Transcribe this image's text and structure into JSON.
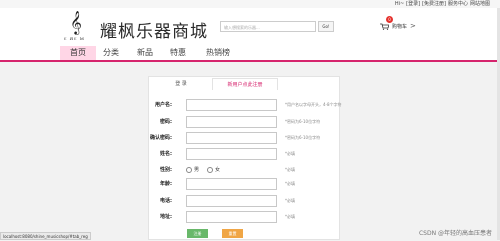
{
  "top_links": [
    "Hi~",
    "[登录]",
    "[免费注册]",
    "服务中心",
    "网站地图"
  ],
  "logo": {
    "sub_text": "Ɛ ЯƐ M"
  },
  "store_name": "耀枫乐器商城",
  "search": {
    "placeholder": "输入想搜索的乐器...",
    "button_label": "Go!"
  },
  "cart": {
    "label": "购物车",
    "count": "0",
    "arrow": ">"
  },
  "nav": {
    "items": [
      {
        "label": "首页",
        "active": true
      },
      {
        "label": "分类",
        "active": false
      },
      {
        "label": "新品",
        "active": false
      },
      {
        "label": "特惠",
        "active": false
      },
      {
        "label": "热销榜",
        "active": false
      }
    ]
  },
  "accent_color": "#d6246d",
  "tabs": {
    "login": "登 录",
    "register": "新用户点此注册"
  },
  "form": {
    "fields": [
      {
        "label": "用户名:",
        "hint": "*用户名以字母开头，4-8个字符"
      },
      {
        "label": "密码:",
        "hint": "*密码为6-10位字符"
      },
      {
        "label": "确认密码:",
        "hint": "*密码为6-10位字符"
      },
      {
        "label": "姓名:",
        "hint": "*必填"
      },
      {
        "label": "性别:",
        "hint": "*必填",
        "options": [
          "男",
          "女"
        ]
      },
      {
        "label": "年龄:",
        "hint": "*必填"
      },
      {
        "label": "电话:",
        "hint": "*必填"
      },
      {
        "label": "地址:",
        "hint": "*必填"
      }
    ],
    "register_button": "注册",
    "reset_button": "重置"
  },
  "status_url": "localhost:8080/shine_musicshop/#tab_reg",
  "watermark": "CSDN @年轻的高血压患者"
}
